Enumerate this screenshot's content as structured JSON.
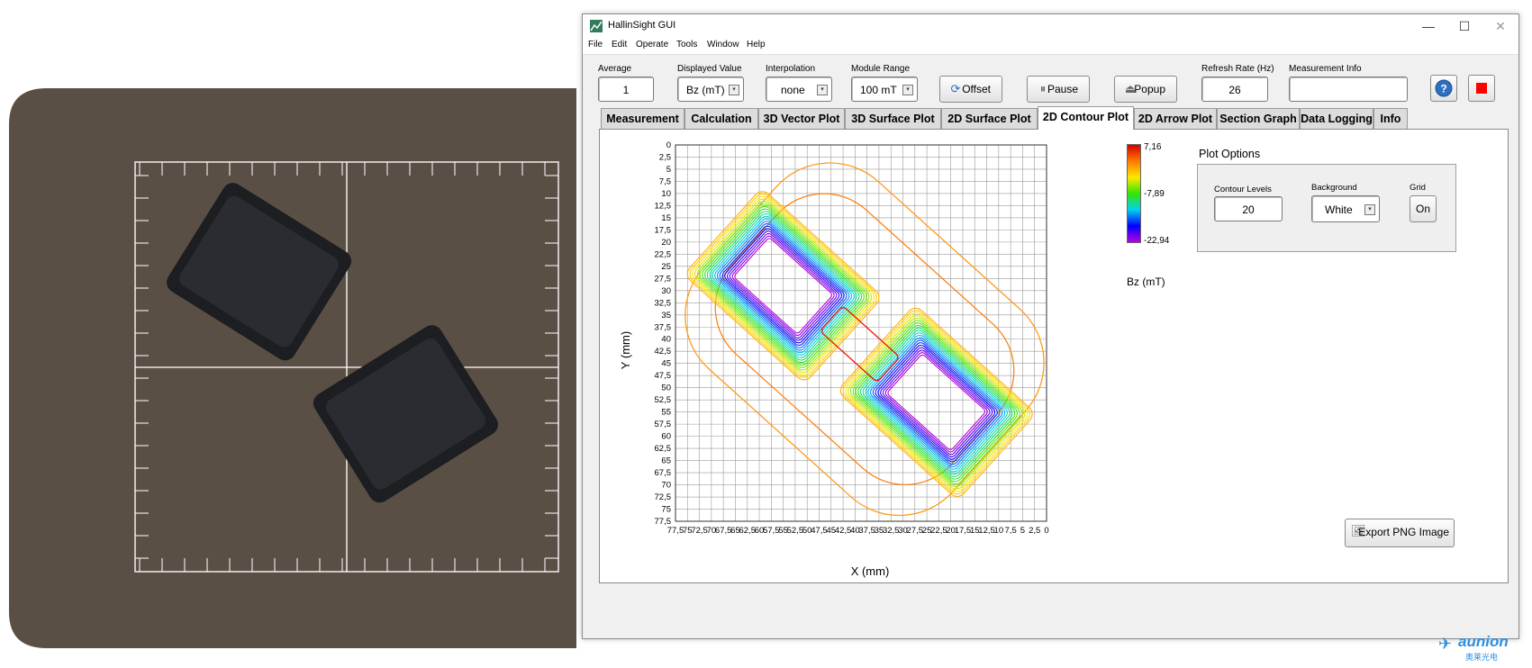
{
  "window": {
    "title": "HallinSight GUI",
    "minimize": "—",
    "maximize": "☐",
    "close": "✕"
  },
  "menu": [
    "File",
    "Edit",
    "Operate",
    "Tools",
    "Window",
    "Help"
  ],
  "controls": {
    "average": {
      "label": "Average",
      "value": "1"
    },
    "displayed_value": {
      "label": "Displayed Value",
      "value": "Bz (mT)"
    },
    "interpolation": {
      "label": "Interpolation",
      "value": "none"
    },
    "module_range": {
      "label": "Module Range",
      "value": "100 mT"
    },
    "offset_button": "Offset",
    "pause_button": "Pause",
    "popup_button": "Popup",
    "refresh_rate": {
      "label": "Refresh Rate (Hz)",
      "value": "26"
    },
    "measurement_info": {
      "label": "Measurement Info",
      "value": ""
    },
    "help_icon": "question-icon",
    "stop_color": "#ff0000"
  },
  "tabs": [
    "Measurement",
    "Calculation",
    "3D Vector Plot",
    "3D Surface Plot",
    "2D Surface Plot",
    "2D Contour Plot",
    "2D Arrow Plot",
    "Section Graph",
    "Data Logging",
    "Info"
  ],
  "active_tab": "2D Contour Plot",
  "chart_data": {
    "type": "contour",
    "xlabel": "X (mm)",
    "ylabel": "Y (mm)",
    "x_ticks": [
      "77,5",
      "75",
      "72,5",
      "70",
      "67,5",
      "65",
      "62,5",
      "60",
      "57,5",
      "55",
      "52,5",
      "50",
      "47,5",
      "45",
      "42,5",
      "40",
      "37,5",
      "35",
      "32,5",
      "30",
      "27,5",
      "25",
      "22,5",
      "20",
      "17,5",
      "15",
      "12,5",
      "10",
      "7,5",
      "5",
      "2,5",
      "0"
    ],
    "y_ticks": [
      "0",
      "2,5",
      "5",
      "7,5",
      "10",
      "12,5",
      "15",
      "17,5",
      "20",
      "22,5",
      "25",
      "27,5",
      "30",
      "32,5",
      "35",
      "37,5",
      "40",
      "42,5",
      "45",
      "47,5",
      "50",
      "52,5",
      "55",
      "57,5",
      "60",
      "62,5",
      "65",
      "67,5",
      "70",
      "72,5",
      "75",
      "77,5"
    ],
    "xlim": [
      77.5,
      0
    ],
    "ylim": [
      0,
      77.5
    ],
    "grid": true,
    "colorscale": {
      "label": "Bz (mT)",
      "ticks": [
        "7,16",
        "-7,89",
        "-22,94"
      ],
      "max": 7.16,
      "mid": -7.89,
      "min": -22.94,
      "colors": [
        "#d60000",
        "#ff7a00",
        "#ffe800",
        "#33e600",
        "#00d2f0",
        "#0000ff",
        "#b900e0"
      ]
    },
    "contour_levels": 20
  },
  "plot_options": {
    "title": "Plot Options",
    "contour_levels": {
      "label": "Contour Levels",
      "value": "20"
    },
    "background": {
      "label": "Background",
      "value": "White"
    },
    "grid": {
      "label": "Grid",
      "value": "On"
    }
  },
  "export_button": "Export PNG Image",
  "watermark": {
    "brand": "aunion",
    "sub": "奥莱光电"
  }
}
